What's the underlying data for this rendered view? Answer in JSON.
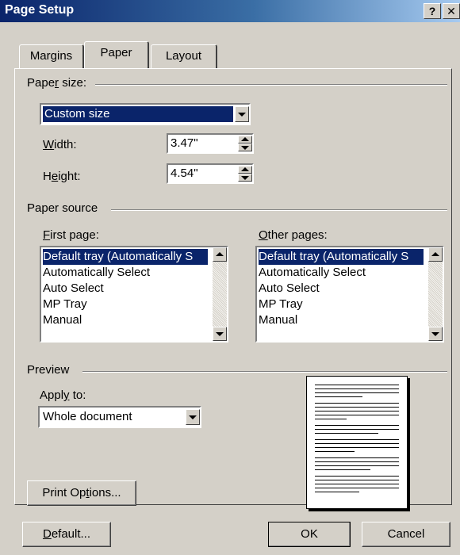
{
  "window": {
    "title": "Page Setup",
    "help_glyph": "?",
    "close_glyph": "✕"
  },
  "tabs": [
    {
      "label": "Margins",
      "active": false
    },
    {
      "label": "Paper",
      "active": true
    },
    {
      "label": "Layout",
      "active": false
    }
  ],
  "paper_size": {
    "group_label_pre": "Pape",
    "group_label_key": "r",
    "group_label_post": " size:",
    "selected": "Custom size",
    "width": {
      "label_key": "W",
      "label_rest": "idth:",
      "value": "3.47\""
    },
    "height": {
      "label_pre": "H",
      "label_key": "e",
      "label_post": "ight:",
      "value": "4.54\""
    }
  },
  "paper_source": {
    "group_label": "Paper source",
    "first_page": {
      "label_key": "F",
      "label_rest": "irst page:",
      "items": [
        "Default tray (Automatically S",
        "Automatically Select",
        "Auto Select",
        "MP Tray",
        "Manual"
      ],
      "selected_index": 0
    },
    "other_pages": {
      "label_key": "O",
      "label_rest": "ther pages:",
      "items": [
        "Default tray (Automatically S",
        "Automatically Select",
        "Auto Select",
        "MP Tray",
        "Manual"
      ],
      "selected_index": 0
    }
  },
  "preview": {
    "group_label": "Preview",
    "apply_to_pre": "Appl",
    "apply_to_key": "y",
    "apply_to_post": " to:",
    "apply_to_value": "Whole document"
  },
  "buttons": {
    "print_options_pre": "Print Op",
    "print_options_key": "t",
    "print_options_post": "ions...",
    "default_key": "D",
    "default_rest": "efault...",
    "ok": "OK",
    "cancel": "Cancel"
  }
}
